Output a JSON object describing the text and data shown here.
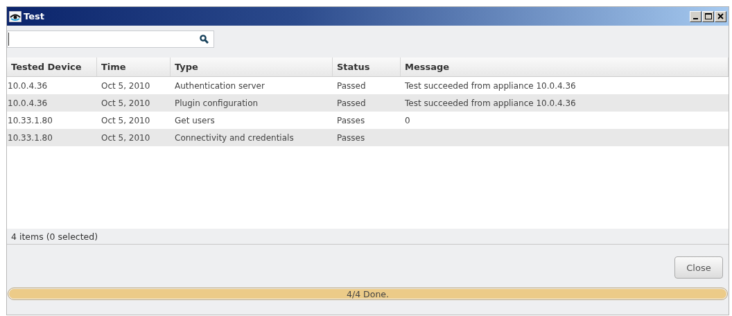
{
  "window": {
    "title": "Test"
  },
  "table": {
    "columns": [
      "Tested Device",
      "Time",
      "Type",
      "Status",
      "Message"
    ],
    "rows": [
      [
        "10.0.4.36",
        "Oct 5, 2010",
        "Authentication server",
        "Passed",
        "Test succeeded from appliance 10.0.4.36"
      ],
      [
        "10.0.4.36",
        "Oct 5, 2010",
        "Plugin configuration",
        "Passed",
        "Test succeeded from appliance 10.0.4.36"
      ],
      [
        "10.33.1.80",
        "Oct 5, 2010",
        "Get users",
        "Passes",
        "0"
      ],
      [
        "10.33.1.80",
        "Oct 5, 2010",
        "Connectivity and credentials",
        "Passes",
        ""
      ]
    ]
  },
  "status_bar": {
    "text": "4 items (0 selected)"
  },
  "buttons": [
    "Close"
  ],
  "progress": {
    "level": 1,
    "text": "4/4 Done."
  }
}
